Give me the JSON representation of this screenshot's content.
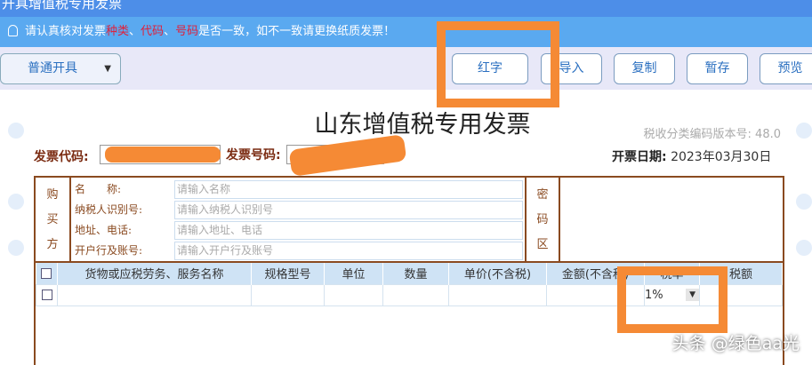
{
  "window": {
    "title": "开具增值税专用发票"
  },
  "notice": {
    "prefix": "请认真核对发票",
    "kind": "种类",
    "sep1": "、",
    "code": "代码",
    "sep2": "、",
    "number": "号码",
    "suffix": "是否一致，如不一致请更换纸质发票！"
  },
  "toolbar": {
    "mode_select": "普通开具",
    "red_label": "红字",
    "import_label": "导入",
    "copy_label": "复制",
    "save_label": "暂存",
    "preview_label": "预览"
  },
  "invoice": {
    "title": "山东增值税专用发票",
    "version": "税收分类编码版本号: 48.0",
    "code_label": "发票代码:",
    "number_label": "发票号码:",
    "date_label": "开票日期:",
    "date": "2023年03月30日"
  },
  "buyer": {
    "side": [
      "购",
      "买",
      "方"
    ],
    "name_label": "名　　称:",
    "name_ph": "请输入名称",
    "taxid_label": "纳税人识别号:",
    "taxid_ph": "请输入纳税人识别号",
    "addr_label": "地址、电话:",
    "addr_ph": "请输入地址、电话",
    "bank_label": "开户行及账号:",
    "bank_ph": "请输入开户行及账号",
    "cipher": [
      "密",
      "码",
      "区"
    ]
  },
  "goods": {
    "headers": [
      "货物或应税劳务、服务名称",
      "规格型号",
      "单位",
      "数量",
      "单价(不含税)",
      "金额(不含税)",
      "税率",
      "税额"
    ],
    "tax_rate": "1%"
  },
  "watermark": "头条 @绿色aa光"
}
